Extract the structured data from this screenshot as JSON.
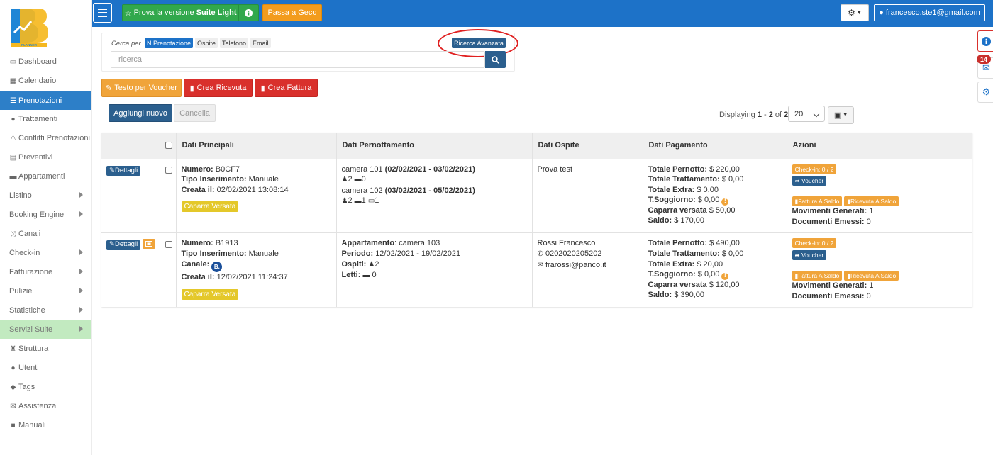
{
  "sidebar": {
    "logo_text": "PLANNER",
    "items": [
      {
        "label": "Dashboard",
        "icon": "dashboard-icon",
        "glyph": "▭"
      },
      {
        "label": "Calendario",
        "icon": "calendar-icon",
        "glyph": "▦"
      },
      {
        "label": "Prenotazioni",
        "icon": "list-icon",
        "glyph": "☰"
      },
      {
        "label": "Trattamenti",
        "icon": "apple-icon",
        "glyph": "●"
      },
      {
        "label": "Conflitti Prenotazioni",
        "icon": "warning-icon",
        "glyph": "⚠"
      },
      {
        "label": "Preventivi",
        "icon": "quote-icon",
        "glyph": "▤"
      },
      {
        "label": "Appartamenti",
        "icon": "bed-icon",
        "glyph": "▬"
      },
      {
        "label": "Listino",
        "icon": "",
        "glyph": ""
      },
      {
        "label": "Booking Engine",
        "icon": "",
        "glyph": ""
      },
      {
        "label": "Canali",
        "icon": "shuffle-icon",
        "glyph": "⤨"
      },
      {
        "label": "Check-in",
        "icon": "",
        "glyph": ""
      },
      {
        "label": "Fatturazione",
        "icon": "",
        "glyph": ""
      },
      {
        "label": "Pulizie",
        "icon": "",
        "glyph": ""
      },
      {
        "label": "Statistiche",
        "icon": "",
        "glyph": ""
      },
      {
        "label": "Servizi Suite",
        "icon": "",
        "glyph": ""
      },
      {
        "label": "Struttura",
        "icon": "tower-icon",
        "glyph": "♜"
      },
      {
        "label": "Utenti",
        "icon": "user-icon",
        "glyph": "●"
      },
      {
        "label": "Tags",
        "icon": "tags-icon",
        "glyph": "◆"
      },
      {
        "label": "Assistenza",
        "icon": "envelope-icon",
        "glyph": "✉"
      },
      {
        "label": "Manuali",
        "icon": "book-icon",
        "glyph": "■"
      }
    ]
  },
  "topbar": {
    "suite_light_prefix": "Prova la versione",
    "suite_light_bold": "Suite Light",
    "geco_label": "Passa a Geco",
    "user_email": "francesco.ste1@gmail.com"
  },
  "notifications": {
    "count": "14"
  },
  "search": {
    "label": "Cerca per",
    "chips": [
      "N.Prenotazione",
      "Ospite",
      "Telefono",
      "Email"
    ],
    "advanced_label": "Ricerca Avanzata",
    "placeholder": "ricerca"
  },
  "actions": {
    "voucher": "Testo per Voucher",
    "ricevuta": "Crea Ricevuta",
    "fattura": "Crea Fattura",
    "add": "Aggiungi nuovo",
    "cancel": "Cancella"
  },
  "pagination": {
    "displaying": "Displaying",
    "from": "1",
    "sep": " - ",
    "to": "2",
    "of": " of ",
    "total": "2",
    "page_size": "20"
  },
  "table": {
    "headers": [
      "Dati Principali",
      "Dati Pernottamento",
      "Dati Ospite",
      "Dati Pagamento",
      "Azioni"
    ],
    "dettagli_label": "Dettagli",
    "rows": [
      {
        "numero_label": "Numero:",
        "numero": "B0CF7",
        "tipo_label": "Tipo Inserimento:",
        "tipo": "Manuale",
        "creata_label": "Creata il:",
        "creata": "02/02/2021 13:08:14",
        "badge": "Caparra Versata",
        "stay1_room": "camera 101",
        "stay1_dates": "(02/02/2021 - 03/02/2021)",
        "stay1_guests": "2",
        "stay1_beds": "0",
        "stay2_room": "camera 102",
        "stay2_dates": "(03/02/2021 - 05/02/2021)",
        "stay2_guests": "2",
        "stay2_beds": "1",
        "stay2_double": "1",
        "guest_name": "Prova test",
        "pay_pernotto_label": "Totale Pernotto:",
        "pay_pernotto": "$ 220,00",
        "pay_tratt_label": "Totale Trattamento:",
        "pay_tratt": "$ 0,00",
        "pay_extra_label": "Totale Extra:",
        "pay_extra": "$ 0,00",
        "pay_sogg_label": "T.Soggiorno:",
        "pay_sogg": "$ 0,00",
        "pay_caparra_label": "Caparra versata",
        "pay_caparra": "$ 50,00",
        "pay_saldo_label": "Saldo:",
        "pay_saldo": "$ 170,00",
        "checkin": "Check-in: 0 / 2",
        "voucher": "Voucher",
        "fattura_saldo": "Fattura A Saldo",
        "ricevuta_saldo": "Ricevuta A Saldo",
        "movimenti_label": "Movimenti Generati:",
        "movimenti": "1",
        "documenti_label": "Documenti Emessi:",
        "documenti": "0"
      },
      {
        "numero_label": "Numero:",
        "numero": "B1913",
        "tipo_label": "Tipo Inserimento:",
        "tipo": "Manuale",
        "canale_label": "Canale:",
        "canale_badge": "B.",
        "creata_label": "Creata il:",
        "creata": "12/02/2021 11:24:37",
        "badge": "Caparra Versata",
        "app_label": "Appartamento",
        "app": "camera 103",
        "periodo_label": "Periodo:",
        "periodo": "12/02/2021 - 19/02/2021",
        "ospiti_label": "Ospiti:",
        "ospiti": "2",
        "letti_label": "Letti:",
        "letti": "0",
        "guest_name": "Rossi Francesco",
        "guest_phone": "0202020205202",
        "guest_email": "frarossi@panco.it",
        "pay_pernotto_label": "Totale Pernotto:",
        "pay_pernotto": "$ 490,00",
        "pay_tratt_label": "Totale Trattamento:",
        "pay_tratt": "$ 0,00",
        "pay_extra_label": "Totale Extra:",
        "pay_extra": "$ 20,00",
        "pay_sogg_label": "T.Soggiorno:",
        "pay_sogg": "$ 0,00",
        "pay_caparra_label": "Caparra versata",
        "pay_caparra": "$ 120,00",
        "pay_saldo_label": "Saldo:",
        "pay_saldo": "$ 390,00",
        "checkin": "Check-in: 0 / 2",
        "voucher": "Voucher",
        "fattura_saldo": "Fattura A Saldo",
        "ricevuta_saldo": "Ricevuta A Saldo",
        "movimenti_label": "Movimenti Generati:",
        "movimenti": "1",
        "documenti_label": "Documenti Emessi:",
        "documenti": "0"
      }
    ]
  },
  "colors": {
    "primary": "#1d72c8",
    "dark_blue": "#2b5f8e",
    "green": "#31a84c",
    "orange": "#f0a43a",
    "red": "#d9302c",
    "yellow": "#e4c82a",
    "annotation": "#e02020"
  }
}
